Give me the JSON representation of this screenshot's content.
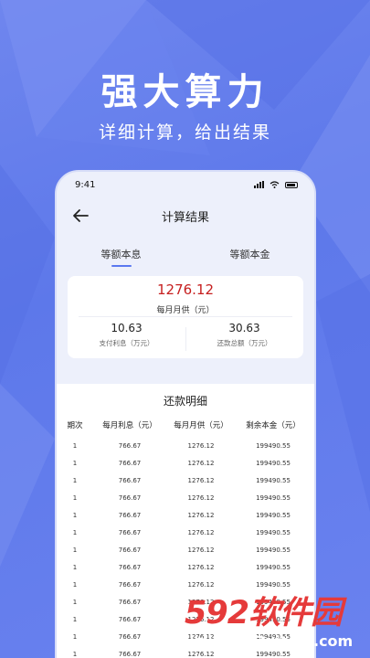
{
  "hero": {
    "title": "强大算力",
    "subtitle": "详细计算，给出结果"
  },
  "status_bar": {
    "time": "9:41"
  },
  "nav": {
    "title": "计算结果",
    "back_icon": "arrow-left-icon"
  },
  "tabs": [
    {
      "label": "等额本息",
      "active": true
    },
    {
      "label": "等额本金",
      "active": false
    }
  ],
  "summary": {
    "monthly_value": "1276.12",
    "monthly_label": "每月月供（元）",
    "interest_value": "10.63",
    "interest_label": "支付利息（万元）",
    "total_value": "30.63",
    "total_label": "还款总额（万元）"
  },
  "detail": {
    "title": "还款明细",
    "headers": [
      "期次",
      "每月利息（元）",
      "每月月供（元）",
      "剩余本金（元）"
    ],
    "rows": [
      [
        "1",
        "766.67",
        "1276.12",
        "199490.55"
      ],
      [
        "1",
        "766.67",
        "1276.12",
        "199490.55"
      ],
      [
        "1",
        "766.67",
        "1276.12",
        "199490.55"
      ],
      [
        "1",
        "766.67",
        "1276.12",
        "199490.55"
      ],
      [
        "1",
        "766.67",
        "1276.12",
        "199490.55"
      ],
      [
        "1",
        "766.67",
        "1276.12",
        "199490.55"
      ],
      [
        "1",
        "766.67",
        "1276.12",
        "199490.55"
      ],
      [
        "1",
        "766.67",
        "1276.12",
        "199490.55"
      ],
      [
        "1",
        "766.67",
        "1276.12",
        "199490.55"
      ],
      [
        "1",
        "766.67",
        "1276.12",
        "199490.55"
      ],
      [
        "1",
        "766.67",
        "1276.12",
        "199490.55"
      ],
      [
        "1",
        "766.67",
        "1276.12",
        "199490.55"
      ],
      [
        "1",
        "766.67",
        "1276.12",
        "199490.55"
      ]
    ]
  },
  "watermark": {
    "brand": "592软件园",
    "url": "www.592xiazai.com"
  },
  "colors": {
    "accent": "#5a78f0",
    "highlight": "#c61f1f",
    "background": "#6a82ef"
  }
}
